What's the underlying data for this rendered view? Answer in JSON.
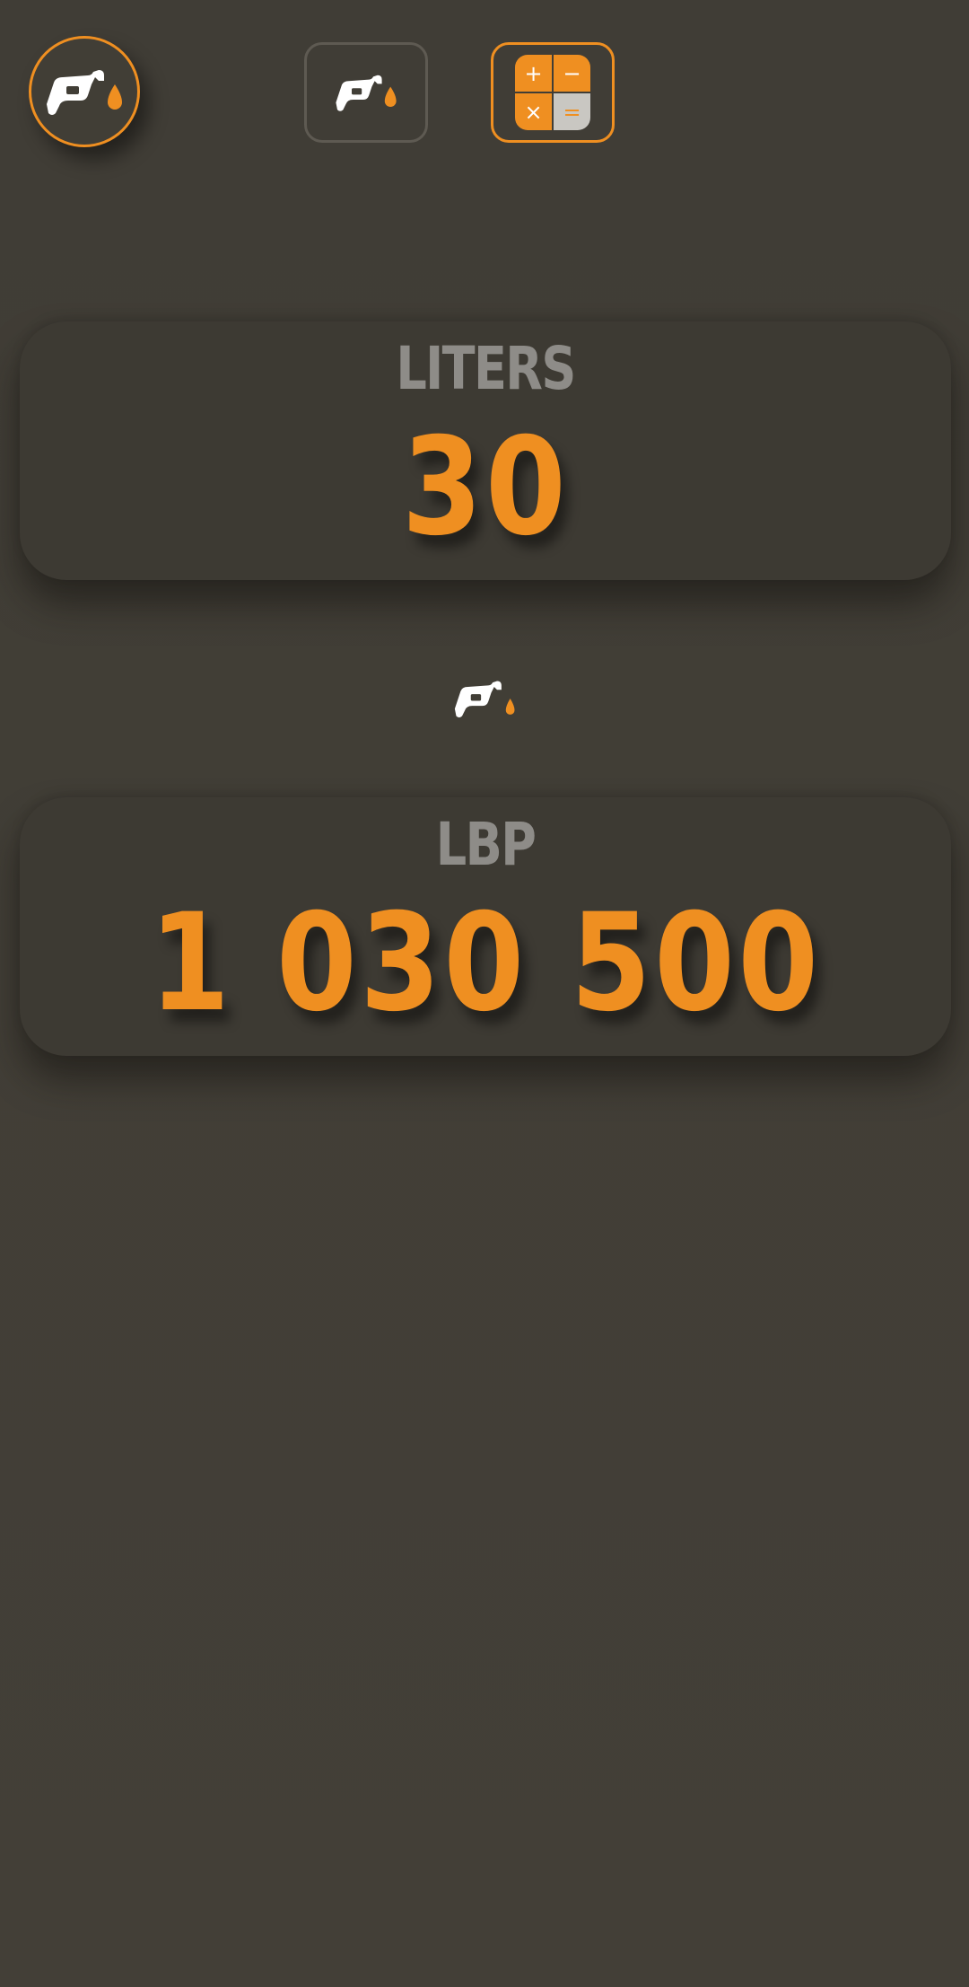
{
  "toolbar": {
    "logo_icon": "fuel-nozzle-drop-icon",
    "fuel_mode_icon": "fuel-nozzle-drop-icon",
    "calculator_mode_icon": "calculator-icon",
    "calculator_symbols": [
      "+",
      "−",
      "×",
      "="
    ],
    "active_mode": "calculator"
  },
  "liters_card": {
    "label": "LITERS",
    "value": "30"
  },
  "separator": {
    "icon": "fuel-nozzle-drop-icon"
  },
  "lbp_card": {
    "label": "LBP",
    "value": "1 030 500"
  },
  "colors": {
    "background": "#413e36",
    "card": "#3d3a33",
    "accent": "#ef8f21",
    "label": "#8e8c88",
    "inactive_border": "#5e5a52"
  }
}
